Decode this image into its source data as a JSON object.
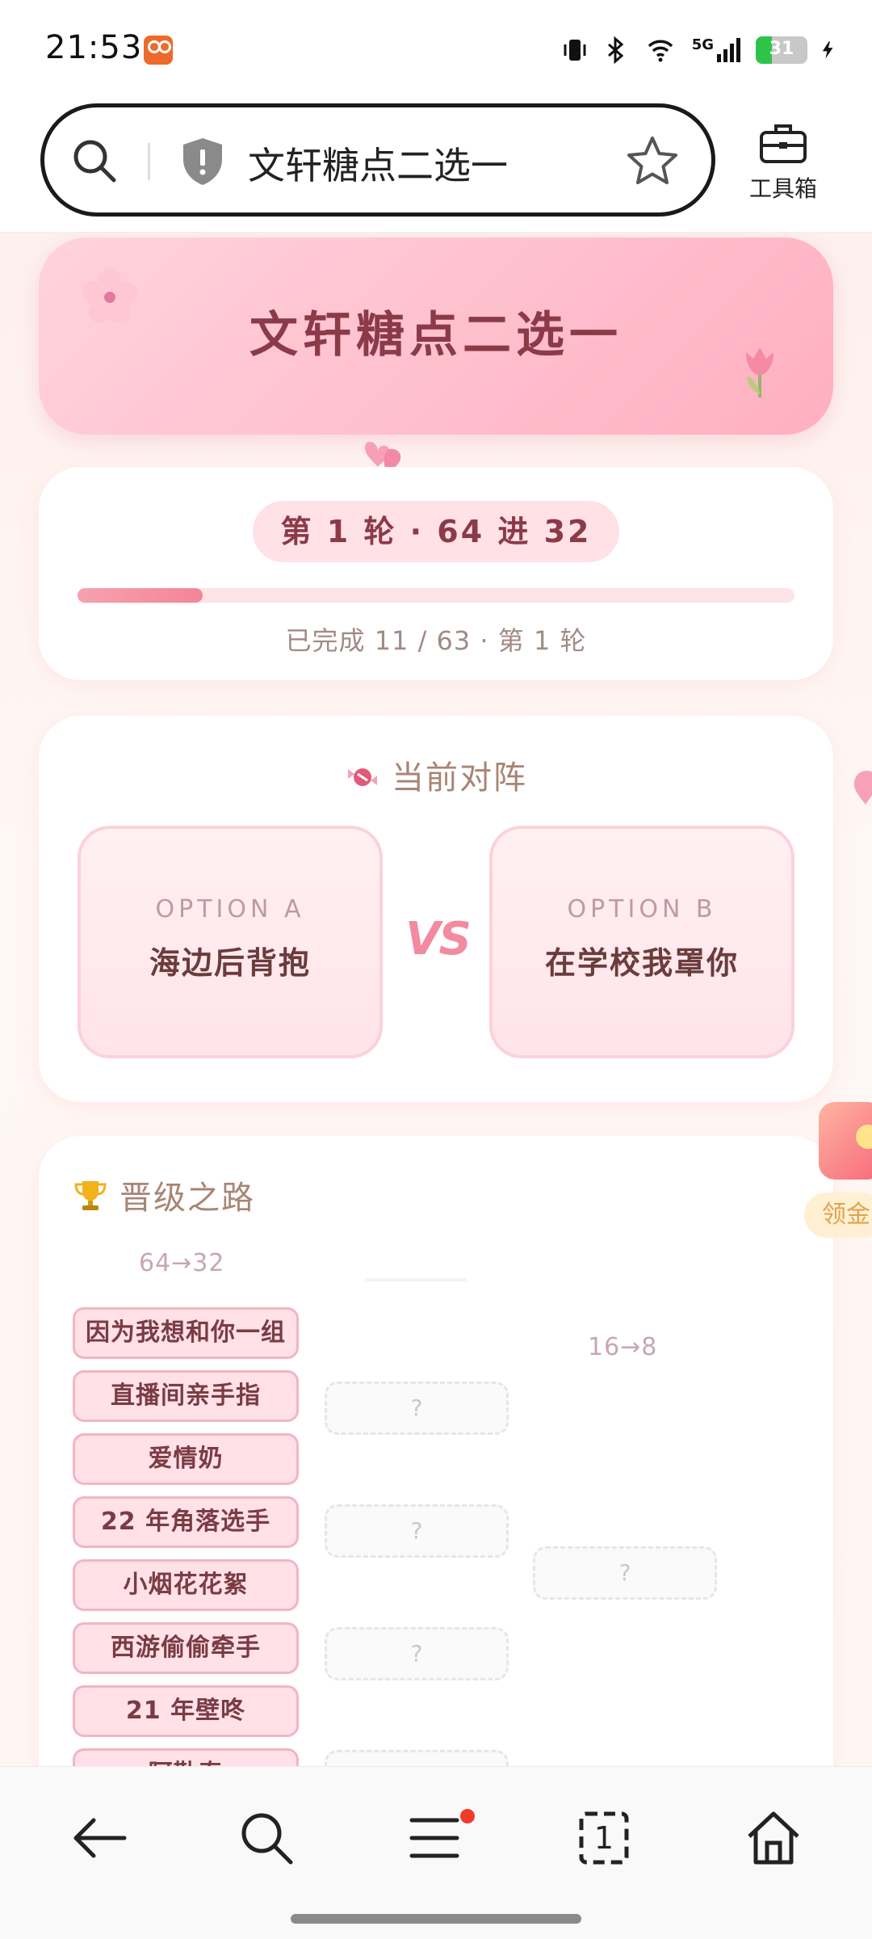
{
  "status_bar": {
    "time": "21:53",
    "network": "5G",
    "battery": "31",
    "icons": [
      "app-icon",
      "vibrate-icon",
      "bluetooth-icon",
      "wifi-icon",
      "signal-icon",
      "battery-icon",
      "charging-icon"
    ]
  },
  "address_bar": {
    "url_text": "文轩糖点二选一",
    "toolbox_label": "工具箱",
    "icons": [
      "search-icon",
      "shield-icon",
      "star-icon",
      "toolbox-icon"
    ]
  },
  "hero": {
    "title": "文轩糖点二选一"
  },
  "round": {
    "pill": "第 1 轮 · 64 进 32",
    "progress_text": "已完成 11 / 63 · 第 1 轮",
    "completed": 11,
    "total": 63,
    "accent_color": "#f38597"
  },
  "match": {
    "title": "当前对阵",
    "option_a_label": "OPTION A",
    "option_a_name": "海边后背抱",
    "vs": "VS",
    "option_b_label": "OPTION B",
    "option_b_name": "在学校我罩你"
  },
  "bracket": {
    "title": "晋级之路",
    "round1_label": "64→32",
    "round3_label": "16→8",
    "entries": [
      "因为我想和你一组",
      "直播间亲手指",
      "爱情奶",
      "22 年角落选手",
      "小烟花花絮",
      "西游偷偷牵手",
      "21 年壁咚",
      "阿勒泰"
    ],
    "slot_placeholder": "?"
  },
  "side_widget": {
    "label": "领金"
  },
  "bottom_nav": {
    "icons": [
      "back-icon",
      "search-icon",
      "menu-icon",
      "tabs-icon",
      "home-icon"
    ],
    "tabs_count": "1"
  }
}
